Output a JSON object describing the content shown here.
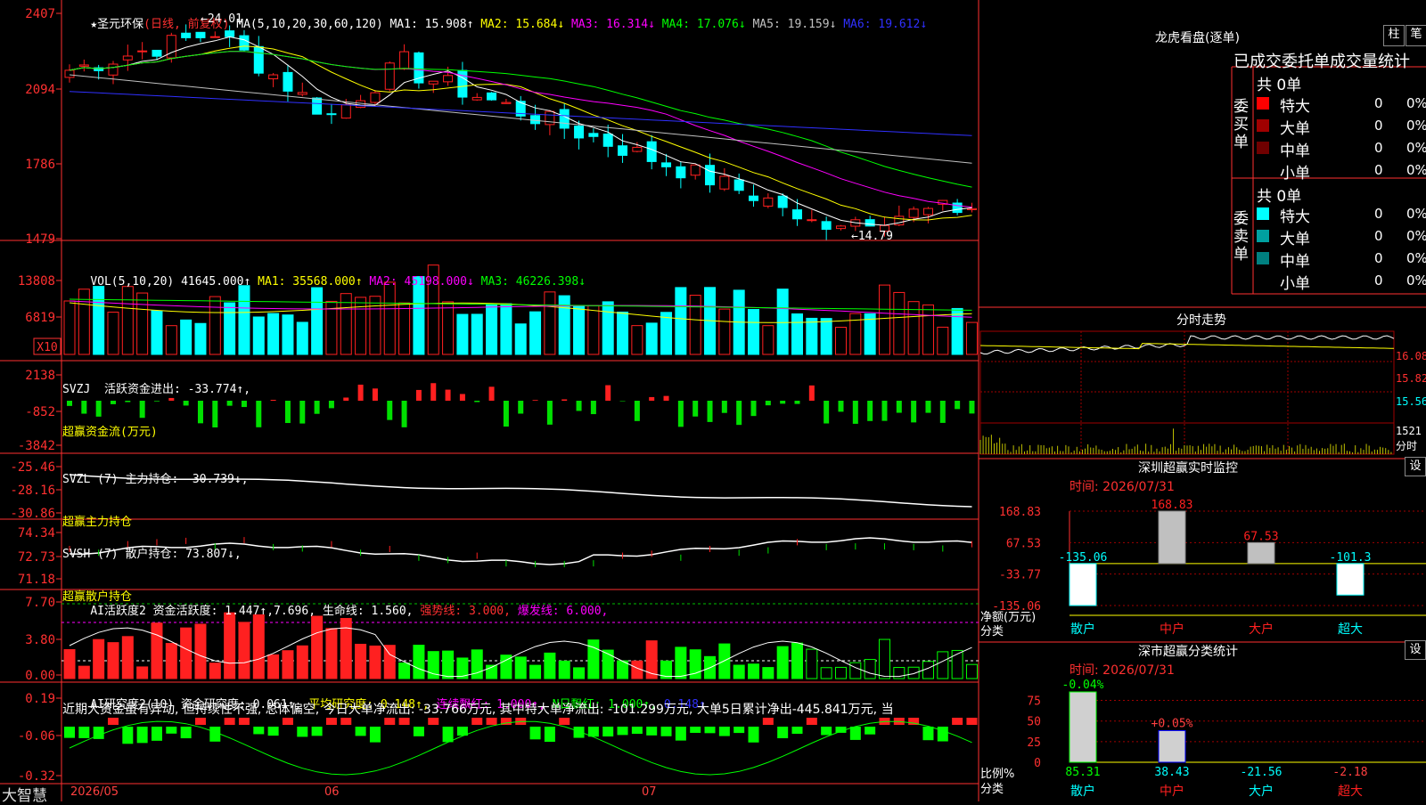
{
  "colors": {
    "up": "#ff2020",
    "down": "#00ffff",
    "ma1": "#ffffff",
    "ma2": "#ffff00",
    "ma3": "#ff00ff",
    "ma4": "#00ff00",
    "ma5": "#c0c0c0",
    "ma6": "#3030ff",
    "grid": "#a00000",
    "axis": "#ff3030"
  },
  "header": {
    "stock": "★圣元环保",
    "period": "(日线, 前复权)",
    "ma_params": "MA(5,10,20,30,60,120)",
    "ma": [
      {
        "label": "MA1: 15.908↑",
        "color": "#ffffff"
      },
      {
        "label": "MA2: 15.684↓",
        "color": "#ffff00"
      },
      {
        "label": "MA3: 16.314↓",
        "color": "#ff00ff"
      },
      {
        "label": "MA4: 17.076↓",
        "color": "#00ff00"
      },
      {
        "label": "MA5: 19.159↓",
        "color": "#c0c0c0"
      },
      {
        "label": "MA6: 19.612↓",
        "color": "#3030ff"
      }
    ],
    "high_mark": "24.01",
    "low_mark": "14.79"
  },
  "price_axis": [
    "2407",
    "2094",
    "1786",
    "1479"
  ],
  "vol": {
    "title": "VOL(5,10,20)",
    "value": "41645.000↑",
    "ma1": "MA1: 35568.000↑",
    "ma2": "MA2: 45198.000↓",
    "ma3": "MA3: 46226.398↓",
    "axis": [
      "13808",
      "6819"
    ],
    "unit": "X10"
  },
  "svzj": {
    "title": "SVZJ  活跃资金进出: -33.774↑,",
    "sub": "超赢资金流(万元)",
    "axis": [
      "2138",
      "-852",
      "-3842"
    ]
  },
  "svzl": {
    "title": "SVZL (7) 主力持仓: -30.739↓,",
    "sub": "超赢主力持仓",
    "axis": [
      "-25.46",
      "-28.16",
      "-30.86"
    ]
  },
  "svsh": {
    "title": "SVSH (7) 散户持仓: 73.807↓,",
    "sub": "超赢散户持仓",
    "axis": [
      "74.34",
      "72.73",
      "71.18"
    ]
  },
  "ai1": {
    "title": "AI活跃度2 资金活跃度: 1.447↑,7.696,",
    "life": "生命线: 1.560,",
    "strong": "强势线: 3.000,",
    "burst": "爆发线: 6.000,",
    "axis": [
      "7.70",
      "3.80",
      "0.00"
    ]
  },
  "ai2": {
    "title": "AI研究度2(10) 资金研究度: 0.061↑,",
    "avg": "平均研究度: 0.148↑,",
    "red": "连续飘红: 1.000↑,",
    "nred": "N日飘红: 1.000↑,",
    "last": "0.148↑",
    "comment": "近期大资金虽有异动, 但持续性不强, 总体偏空, 今日大单净流出: -33.766万元, 其中特大单净流出: -101.299万元, 大单5日累计净出-445.841万元, 当",
    "axis": [
      "0.19",
      "-0.06",
      "-0.32"
    ]
  },
  "xaxis": {
    "d1": "2026/05",
    "d2": "06",
    "d3": "07"
  },
  "brand": "大智慧",
  "lhk": {
    "title": "龙虎看盘(逐单)",
    "btn1": "柱",
    "btn2": "笔",
    "subtitle": "已成交委托单成交量统计",
    "buy": {
      "side": "委买单",
      "total": "共 0单",
      "rows": [
        {
          "name": "特大",
          "v": "0",
          "p": "0%",
          "c": "#ff0000"
        },
        {
          "name": "大单",
          "v": "0",
          "p": "0%",
          "c": "#a00000"
        },
        {
          "name": "中单",
          "v": "0",
          "p": "0%",
          "c": "#700000"
        },
        {
          "name": "小单",
          "v": "0",
          "p": "0%",
          "c": "#000000"
        }
      ]
    },
    "sell": {
      "side": "委卖单",
      "total": "共 0单",
      "rows": [
        {
          "name": "特大",
          "v": "0",
          "p": "0%",
          "c": "#00ffff"
        },
        {
          "name": "大单",
          "v": "0",
          "p": "0%",
          "c": "#00a0a0"
        },
        {
          "name": "中单",
          "v": "0",
          "p": "0%",
          "c": "#008080"
        },
        {
          "name": "小单",
          "v": "0",
          "p": "0%",
          "c": "#000000"
        }
      ]
    }
  },
  "intraday": {
    "title": "分时走势",
    "axis": [
      "16.08",
      "15.82",
      "15.56",
      "1521",
      "分时"
    ]
  },
  "sz_monitor": {
    "title": "深圳超赢实时监控",
    "btn": "设",
    "time": "时间: 2026/07/31",
    "axis": [
      "168.83",
      "67.53",
      "-33.77",
      "-135.06"
    ],
    "ylabel": "净额(万元)",
    "xlabel": "分类",
    "chart_data": {
      "type": "bar",
      "categories": [
        "散户",
        "中户",
        "大户",
        "超大"
      ],
      "values": [
        -135.06,
        168.83,
        67.53,
        -101.3
      ],
      "labels": [
        "-135.06",
        "168.83",
        "67.53",
        "-101.3"
      ],
      "ylim": [
        -135.06,
        168.83
      ]
    }
  },
  "sz_class": {
    "title": "深市超赢分类统计",
    "btn": "设",
    "time": "时间: 2026/07/31",
    "axis": [
      "75",
      "50",
      "25",
      "0"
    ],
    "ylabel": "比例%",
    "xlabel": "分类",
    "chart_data": {
      "type": "bar",
      "categories": [
        "散户",
        "中户",
        "大户",
        "超大"
      ],
      "values": [
        85.31,
        38.43,
        -21.56,
        -2.18
      ],
      "top_labels": [
        "-0.04%",
        "+0.05%",
        "",
        ""
      ],
      "bottom_labels": [
        "85.31",
        "38.43",
        "-21.56",
        "-2.18"
      ],
      "ylim": [
        0,
        85.31
      ]
    }
  }
}
